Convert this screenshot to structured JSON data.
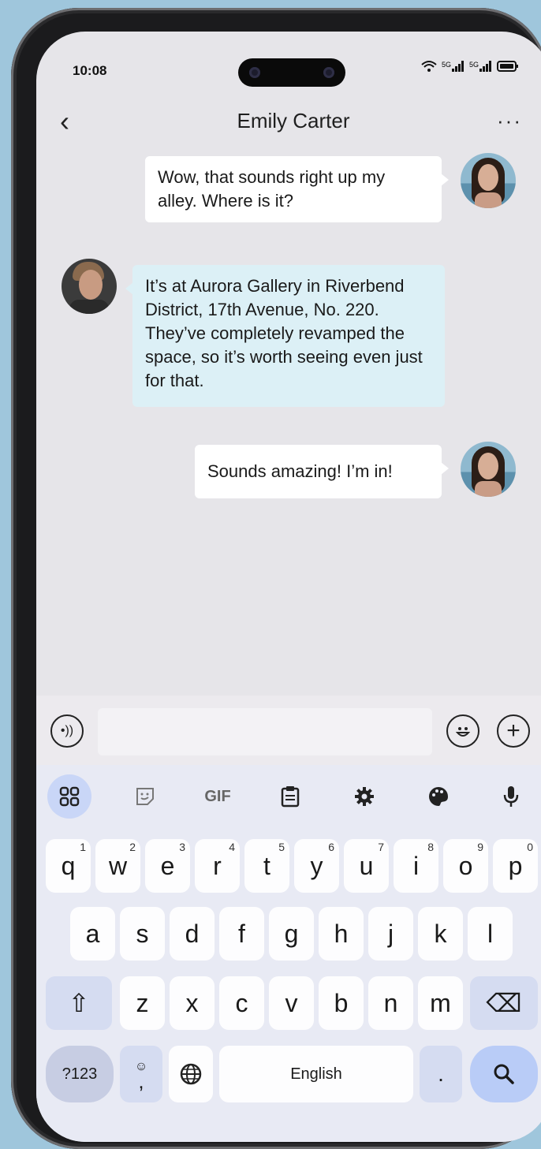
{
  "status": {
    "time": "10:08",
    "signal1": "5G",
    "signal2": "5G"
  },
  "header": {
    "back_glyph": "‹",
    "contact_name": "Emily Carter",
    "more_glyph": "···"
  },
  "messages": [
    {
      "side": "out",
      "text": "Wow, that sounds right up my alley. Where is it?"
    },
    {
      "side": "in",
      "text": "It’s at Aurora Gallery in Riverbend District, 17th Avenue, No. 220. They’ve completely revamped the space, so it’s worth seeing even just for that."
    },
    {
      "side": "out",
      "text": "Sounds amazing! I’m in!"
    }
  ],
  "input": {
    "placeholder": ""
  },
  "keyboard": {
    "toolbar": [
      "apps-grid-icon",
      "sticker-icon",
      "GIF",
      "clipboard-icon",
      "settings-gear-icon",
      "theme-palette-icon",
      "microphone-icon"
    ],
    "gif_label": "GIF",
    "row1": [
      {
        "k": "q",
        "h": "1"
      },
      {
        "k": "w",
        "h": "2"
      },
      {
        "k": "e",
        "h": "3"
      },
      {
        "k": "r",
        "h": "4"
      },
      {
        "k": "t",
        "h": "5"
      },
      {
        "k": "y",
        "h": "6"
      },
      {
        "k": "u",
        "h": "7"
      },
      {
        "k": "i",
        "h": "8"
      },
      {
        "k": "o",
        "h": "9"
      },
      {
        "k": "p",
        "h": "0"
      }
    ],
    "row2": [
      "a",
      "s",
      "d",
      "f",
      "g",
      "h",
      "j",
      "k",
      "l"
    ],
    "row3": [
      "z",
      "x",
      "c",
      "v",
      "b",
      "n",
      "m"
    ],
    "shift_glyph": "⇧",
    "backspace_glyph": "⌫",
    "numbers_label": "?123",
    "emoji_comma_top": "☺",
    "emoji_comma_bottom": ",",
    "globe_glyph": "🌐",
    "space_label": "English",
    "period_label": ".",
    "search_glyph": "🔍"
  },
  "colors": {
    "bubble_in": "#dcf0f6",
    "bubble_out": "#ffffff",
    "keyboard_bg": "#e8eaf4",
    "accent_key": "#b9ccf7"
  }
}
